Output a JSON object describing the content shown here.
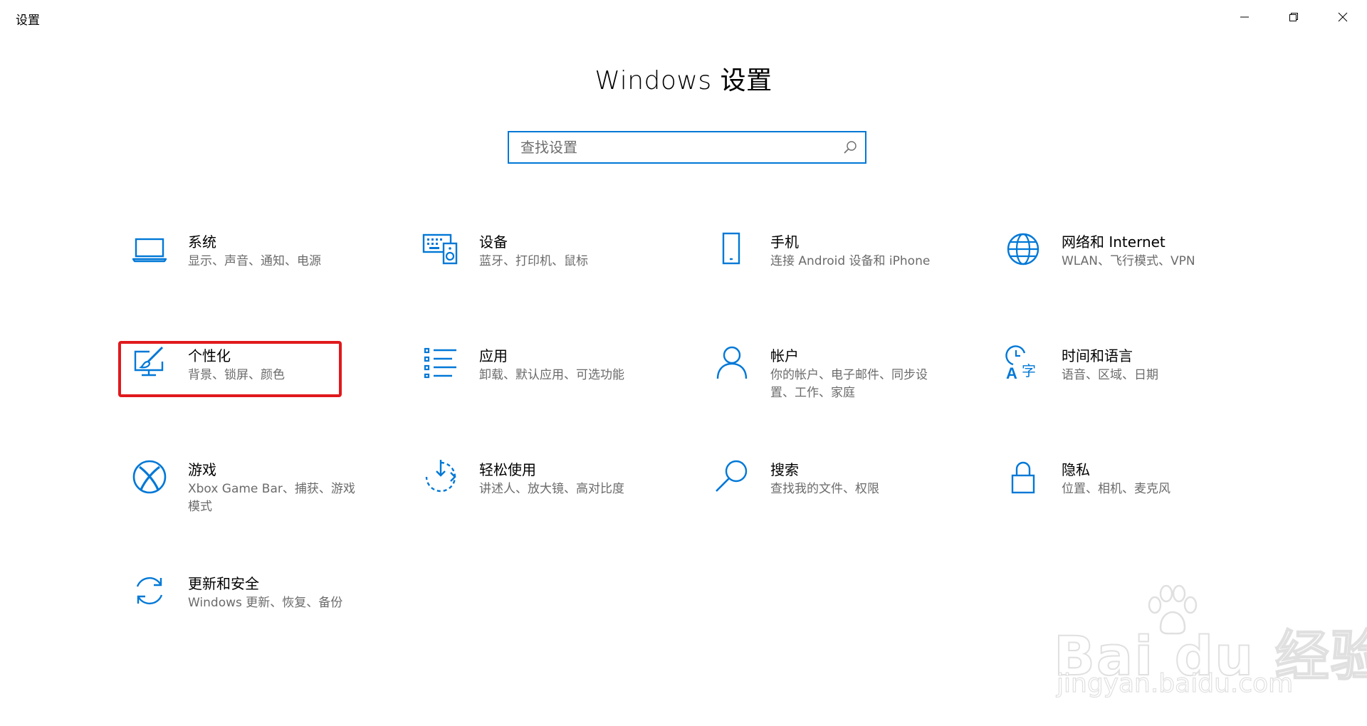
{
  "window": {
    "title": "设置",
    "controls": [
      "minimize",
      "restore",
      "close"
    ]
  },
  "page": {
    "title": "Windows 设置"
  },
  "search": {
    "placeholder": "查找设置",
    "value": ""
  },
  "tiles": [
    {
      "id": "system",
      "icon": "laptop-icon",
      "name": "系统",
      "desc": "显示、声音、通知、电源"
    },
    {
      "id": "devices",
      "icon": "devices-icon",
      "name": "设备",
      "desc": "蓝牙、打印机、鼠标"
    },
    {
      "id": "phone",
      "icon": "phone-icon",
      "name": "手机",
      "desc": "连接 Android 设备和 iPhone"
    },
    {
      "id": "network",
      "icon": "globe-icon",
      "name": "网络和 Internet",
      "desc": "WLAN、飞行模式、VPN"
    },
    {
      "id": "personalization",
      "icon": "paint-brush-monitor-icon",
      "name": "个性化",
      "desc": "背景、锁屏、颜色"
    },
    {
      "id": "apps",
      "icon": "app-list-icon",
      "name": "应用",
      "desc": "卸载、默认应用、可选功能"
    },
    {
      "id": "accounts",
      "icon": "person-icon",
      "name": "帐户",
      "desc": "你的帐户、电子邮件、同步设置、工作、家庭"
    },
    {
      "id": "time-language",
      "icon": "time-language-icon",
      "name": "时间和语言",
      "desc": "语音、区域、日期"
    },
    {
      "id": "gaming",
      "icon": "xbox-icon",
      "name": "游戏",
      "desc": "Xbox Game Bar、捕获、游戏模式"
    },
    {
      "id": "ease-of-access",
      "icon": "ease-of-access-icon",
      "name": "轻松使用",
      "desc": "讲述人、放大镜、高对比度"
    },
    {
      "id": "search",
      "icon": "magnifier-icon",
      "name": "搜索",
      "desc": "查找我的文件、权限"
    },
    {
      "id": "privacy",
      "icon": "lock-icon",
      "name": "隐私",
      "desc": "位置、相机、麦克风"
    },
    {
      "id": "update-security",
      "icon": "sync-arrows-icon",
      "name": "更新和安全",
      "desc": "Windows 更新、恢复、备份"
    }
  ],
  "highlighted_tile": "personalization",
  "colors": {
    "accent": "#0078d7",
    "highlight": "#e0191c",
    "secondary_text": "#6b6b6b"
  },
  "watermark": {
    "brand": "Bai du 经验",
    "url": "jingyan.baidu.com"
  }
}
